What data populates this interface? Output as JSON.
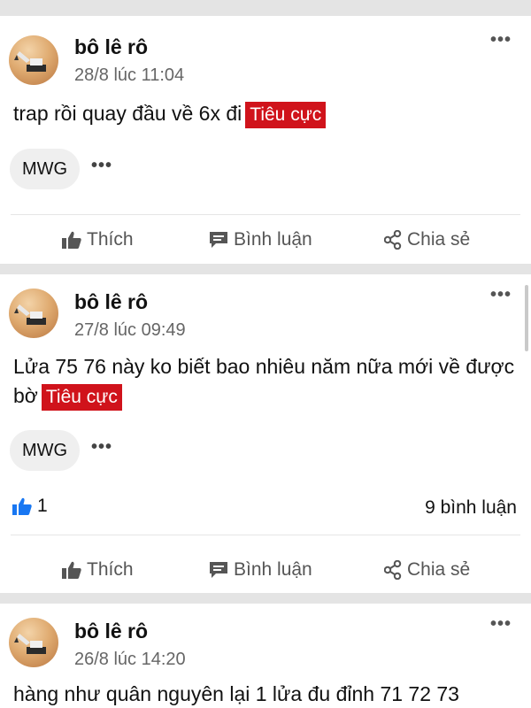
{
  "feed": {
    "posts": [
      {
        "author": "bô lê rô",
        "time": "28/8 lúc 11:04",
        "text": "trap rồi quay đầu về 6x đi",
        "tag": "Tiêu cực",
        "chip": "MWG",
        "actions": {
          "like": "Thích",
          "comment": "Bình luận",
          "share": "Chia sẻ"
        }
      },
      {
        "author": "bô lê rô",
        "time": "27/8 lúc 09:49",
        "text": "Lửa 75 76 này ko biết bao nhiêu năm nữa mới về được bờ",
        "tag": "Tiêu cực",
        "chip": "MWG",
        "like_count": "1",
        "comment_count": "9 bình luận",
        "actions": {
          "like": "Thích",
          "comment": "Bình luận",
          "share": "Chia sẻ"
        }
      },
      {
        "author": "bô lê rô",
        "time": "26/8 lúc 14:20",
        "text": "hàng như quân nguyên lại 1 lửa đu đỉnh 71 72 73"
      }
    ]
  },
  "icons": {
    "more": "ellipsis-icon",
    "like": "thumbs-up-icon",
    "comment": "comment-icon",
    "share": "share-icon"
  },
  "colors": {
    "tag_bg": "#d0131b",
    "like_blue": "#1877f2",
    "separator": "#e4e4e4"
  }
}
